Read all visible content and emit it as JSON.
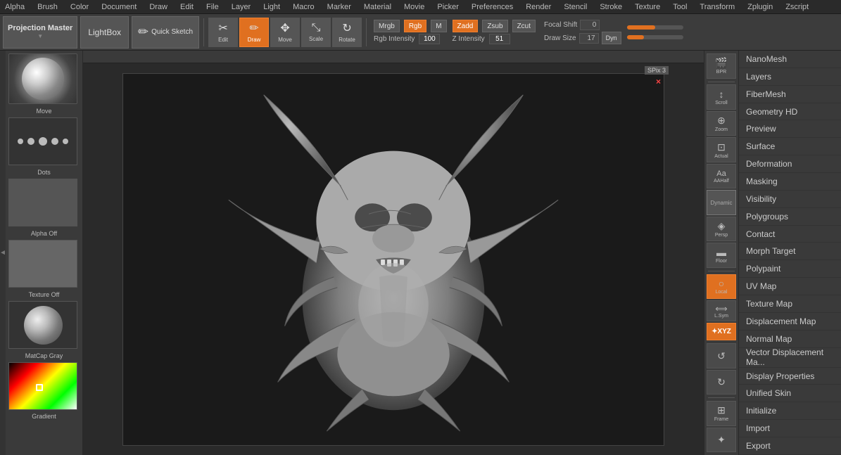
{
  "topMenu": {
    "items": [
      "Alpha",
      "Brush",
      "Color",
      "Document",
      "Draw",
      "Edit",
      "File",
      "Layer",
      "Light",
      "Macro",
      "Marker",
      "Material",
      "Movie",
      "Picker",
      "Preferences",
      "Render",
      "Stencil",
      "Stroke",
      "Texture",
      "Tool",
      "Transform",
      "Zplugin",
      "Zscript"
    ]
  },
  "toolbar": {
    "projectionMaster": "Projection Master",
    "lightbox": "LightBox",
    "quickSketch": "Quick Sketch",
    "tools": [
      "Edit",
      "Draw",
      "Move",
      "Scale",
      "Rotate"
    ],
    "activeToolIndex": 1,
    "mrgb": "Mrgb",
    "rgb": "Rgb",
    "m": "M",
    "zadd": "Zadd",
    "zsub": "Zsub",
    "zcut": "Zcut",
    "rgbLabel": "Rgb Intensity",
    "rgbValue": "100",
    "zIntLabel": "Z Intensity",
    "zIntValue": "51",
    "focalShiftLabel": "Focal Shift",
    "focalShiftValue": "0",
    "drawSizeLabel": "Draw Size",
    "drawSizeValue": "17",
    "dyn": "Dyn"
  },
  "leftPanel": {
    "moveLabel": "Move",
    "dotsLabel": "Dots",
    "alphaOffLabel": "Alpha Off",
    "textureOffLabel": "Texture Off",
    "matcapLabel": "MatCap Gray",
    "gradientLabel": "Gradient"
  },
  "rightToolPanel": {
    "buttons": [
      {
        "label": "BPR",
        "icon": "📷"
      },
      {
        "label": "SPix 3",
        "icon": ""
      },
      {
        "label": "Scroll",
        "icon": "⬆"
      },
      {
        "label": "Zoom",
        "icon": "🔍"
      },
      {
        "label": "Actual",
        "icon": "⊡"
      },
      {
        "label": "AAHalf",
        "icon": "Aa"
      },
      {
        "label": "Dynamic",
        "icon": "⊟"
      },
      {
        "label": "Persp",
        "icon": "◈"
      },
      {
        "label": "Floor",
        "icon": "▭"
      },
      {
        "label": "Local",
        "icon": "○",
        "active": true
      },
      {
        "label": "L.Sym",
        "icon": "⟺"
      },
      {
        "label": "Frame",
        "icon": "⊡"
      }
    ]
  },
  "farRightPanel": {
    "items": [
      "NanoMesh",
      "Layers",
      "FiberMesh",
      "Geometry HD",
      "Preview",
      "Surface",
      "Deformation",
      "Masking",
      "Visibility",
      "Polygroups",
      "Contact",
      "Morph Target",
      "Polypaint",
      "UV Map",
      "Texture Map",
      "Displacement Map",
      "Normal Map",
      "Vector Displacement Ma...",
      "Display Properties",
      "Unified Skin",
      "Initialize",
      "Import",
      "Export"
    ]
  }
}
